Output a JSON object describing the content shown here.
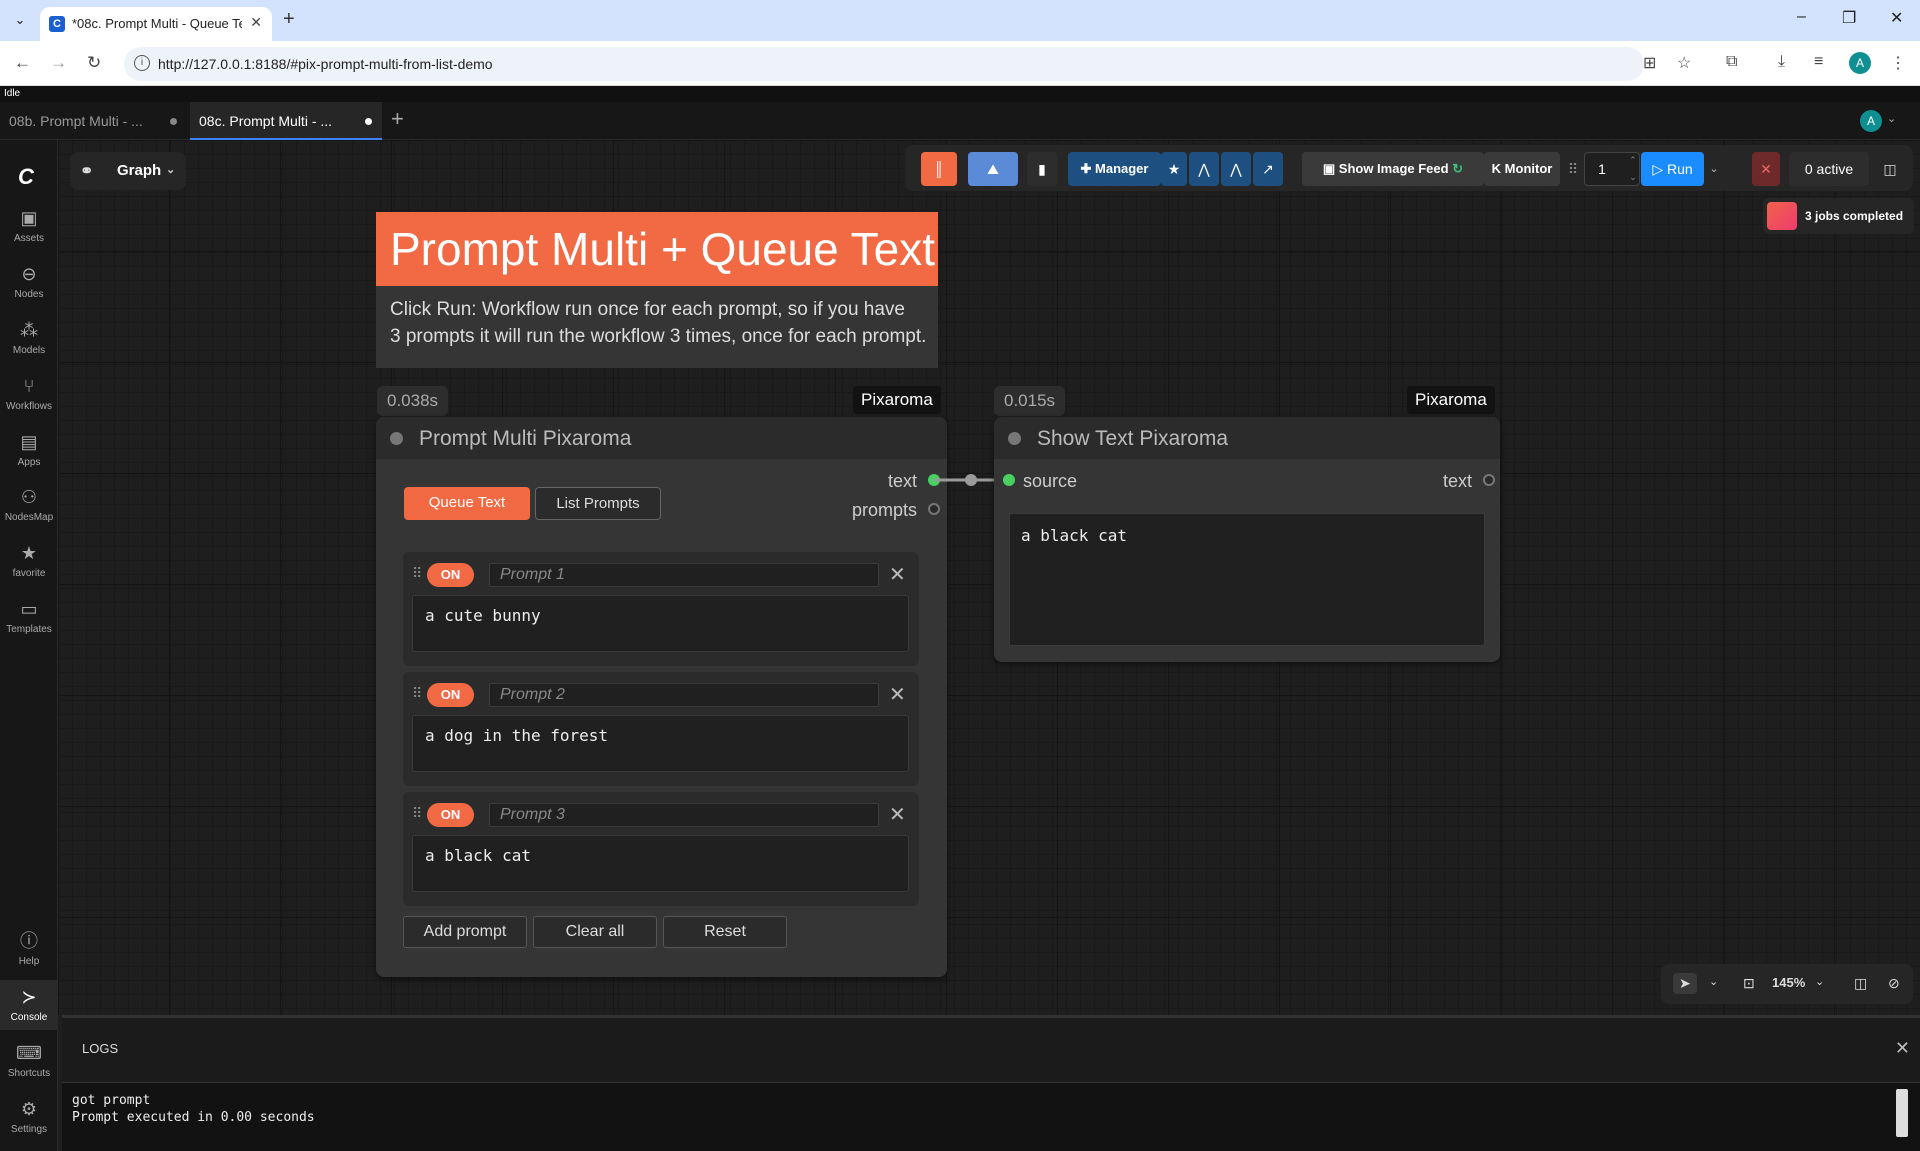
{
  "browser": {
    "tab_title": "*08c. Prompt Multi - Queue Te",
    "url": "http://127.0.0.1:8188/#pix-prompt-multi-from-list-demo",
    "profile_initial": "A"
  },
  "app": {
    "status": "Idle",
    "workflow_tabs": [
      {
        "label": "08b. Prompt Multi - ..."
      },
      {
        "label": "08c. Prompt Multi - ..."
      }
    ],
    "user_initial": "A"
  },
  "sidebar": {
    "items": [
      {
        "label": "Assets",
        "icon": "image-icon"
      },
      {
        "label": "Nodes",
        "icon": "node-icon"
      },
      {
        "label": "Models",
        "icon": "models-icon"
      },
      {
        "label": "Workflows",
        "icon": "workflow-icon"
      },
      {
        "label": "Apps",
        "icon": "apps-icon"
      },
      {
        "label": "NodesMap",
        "icon": "nodesmap-icon"
      },
      {
        "label": "favorite",
        "icon": "star-icon"
      },
      {
        "label": "Templates",
        "icon": "templates-icon"
      },
      {
        "label": "Help",
        "icon": "help-icon"
      },
      {
        "label": "Console",
        "icon": "console-icon"
      },
      {
        "label": "Shortcuts",
        "icon": "keyboard-icon"
      },
      {
        "label": "Settings",
        "icon": "gear-icon"
      }
    ]
  },
  "graph_menu": {
    "label": "Graph"
  },
  "toolbar": {
    "manager_label": "Manager",
    "image_feed_label": "Show Image Feed",
    "monitor_label": "Monitor",
    "queue_count": "1",
    "run_label": "Run",
    "active_label": "0 active",
    "jobs_label": "3 jobs completed",
    "accent_color": "#1a8cff"
  },
  "note": {
    "title": "Prompt Multi + Queue Text",
    "description_line1": "Click Run: Workflow run once for each prompt, so if you have",
    "description_line2": "3 prompts it will run the workflow 3 times, once for each prompt.",
    "color": "#f26a43"
  },
  "node_prompt": {
    "time": "0.038s",
    "tag": "Pixaroma",
    "title": "Prompt Multi Pixaroma",
    "out_text": "text",
    "out_prompts": "prompts",
    "tab_queue": "Queue Text",
    "tab_list": "List Prompts",
    "prompts": [
      {
        "toggle": "ON",
        "name_placeholder": "Prompt 1",
        "text": "a cute bunny"
      },
      {
        "toggle": "ON",
        "name_placeholder": "Prompt 2",
        "text": "a dog in the forest"
      },
      {
        "toggle": "ON",
        "name_placeholder": "Prompt 3",
        "text": "a black cat"
      }
    ],
    "add_label": "Add prompt",
    "clear_label": "Clear all",
    "reset_label": "Reset"
  },
  "node_show": {
    "time": "0.015s",
    "tag": "Pixaroma",
    "title": "Show Text Pixaroma",
    "in_source": "source",
    "out_text": "text",
    "content": "a black cat"
  },
  "view_controls": {
    "zoom": "145%"
  },
  "logs": {
    "title": "LOGS",
    "lines": [
      "got prompt",
      "Prompt executed in 0.00 seconds"
    ]
  }
}
